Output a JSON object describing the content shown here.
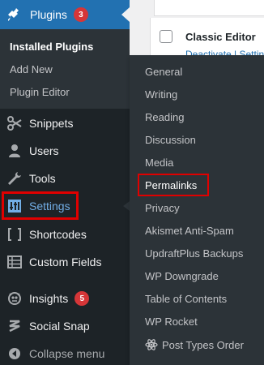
{
  "sidebar": {
    "plugins": {
      "label": "Plugins",
      "badge": "3",
      "icon": "plugin-icon"
    },
    "plugins_submenu": [
      {
        "label": "Installed Plugins",
        "current": true
      },
      {
        "label": "Add New",
        "current": false
      },
      {
        "label": "Plugin Editor",
        "current": false
      }
    ],
    "items": [
      {
        "label": "Snippets",
        "icon": "scissors-icon"
      },
      {
        "label": "Users",
        "icon": "users-icon"
      },
      {
        "label": "Tools",
        "icon": "wrench-icon"
      },
      {
        "label": "Settings",
        "icon": "settings-sliders-icon"
      },
      {
        "label": "Shortcodes",
        "icon": "brackets-icon"
      },
      {
        "label": "Custom Fields",
        "icon": "grid-table-icon"
      },
      {
        "label": "Insights",
        "icon": "insights-icon",
        "badge": "5"
      },
      {
        "label": "Social Snap",
        "icon": "social-snap-icon"
      },
      {
        "label": "Collapse menu",
        "icon": "collapse-arrow-icon"
      }
    ]
  },
  "settings_flyout": {
    "items": [
      {
        "label": "General"
      },
      {
        "label": "Writing"
      },
      {
        "label": "Reading"
      },
      {
        "label": "Discussion"
      },
      {
        "label": "Media"
      },
      {
        "label": "Permalinks"
      },
      {
        "label": "Privacy"
      },
      {
        "label": "Akismet Anti-Spam"
      },
      {
        "label": "UpdraftPlus Backups"
      },
      {
        "label": "WP Downgrade"
      },
      {
        "label": "Table of Contents"
      },
      {
        "label": "WP Rocket"
      },
      {
        "label": "Post Types Order",
        "icon": "atom-icon"
      }
    ]
  },
  "content": {
    "plugin_row": {
      "title": "Classic Editor",
      "link": "Deactivate | Settings"
    }
  },
  "colors": {
    "sidebar_bg": "#1d2327",
    "submenu_bg": "#2c3338",
    "active_blue": "#2271b1",
    "badge_red": "#d63638",
    "highlight_red": "#e00000"
  }
}
